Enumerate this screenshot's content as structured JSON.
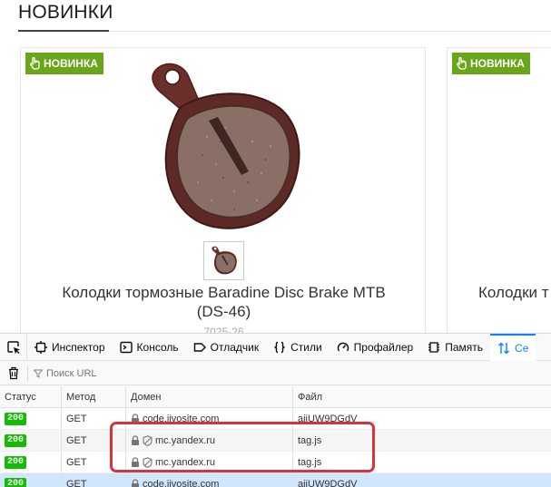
{
  "shop": {
    "section_title": "НОВИНКИ",
    "cards": [
      {
        "badge": "НОВИНКА",
        "name_line1": "Колодки тормозные Baradine Disc Brake MTB",
        "name_line2": "(DS-46)",
        "sku": "7025-26"
      },
      {
        "badge": "НОВИНКА",
        "name": "Колодки т"
      }
    ],
    "colors": {
      "badge": "#6aa61a"
    }
  },
  "devtools": {
    "tabs": [
      {
        "label": "Инспектор",
        "icon": "inspector-icon"
      },
      {
        "label": "Консоль",
        "icon": "console-icon"
      },
      {
        "label": "Отладчик",
        "icon": "debugger-icon"
      },
      {
        "label": "Стили",
        "icon": "style-editor-icon"
      },
      {
        "label": "Профайлер",
        "icon": "profiler-icon"
      },
      {
        "label": "Память",
        "icon": "memory-icon"
      },
      {
        "label": "Се",
        "icon": "network-icon",
        "active": true
      }
    ],
    "filter_placeholder": "Поиск URL",
    "columns": {
      "status": "Статус",
      "method": "Метод",
      "domain": "Домен",
      "file": "Файл"
    },
    "requests": [
      {
        "status": "200",
        "method": "GET",
        "domain": "code.jivosite.com",
        "file": "ajiUW9DGdV",
        "tracker": false
      },
      {
        "status": "200",
        "method": "GET",
        "domain": "mc.yandex.ru",
        "file": "tag.js",
        "tracker": true
      },
      {
        "status": "200",
        "method": "GET",
        "domain": "mc.yandex.ru",
        "file": "tag.js",
        "tracker": true
      },
      {
        "status": "200",
        "method": "GET",
        "domain": "code.jivosite.com",
        "file": "ajiUW9DGdV",
        "tracker": false
      }
    ],
    "colors": {
      "active_tab": "#0a84ff",
      "status_ok": "#12bc00",
      "highlight": "#d6343a"
    }
  }
}
